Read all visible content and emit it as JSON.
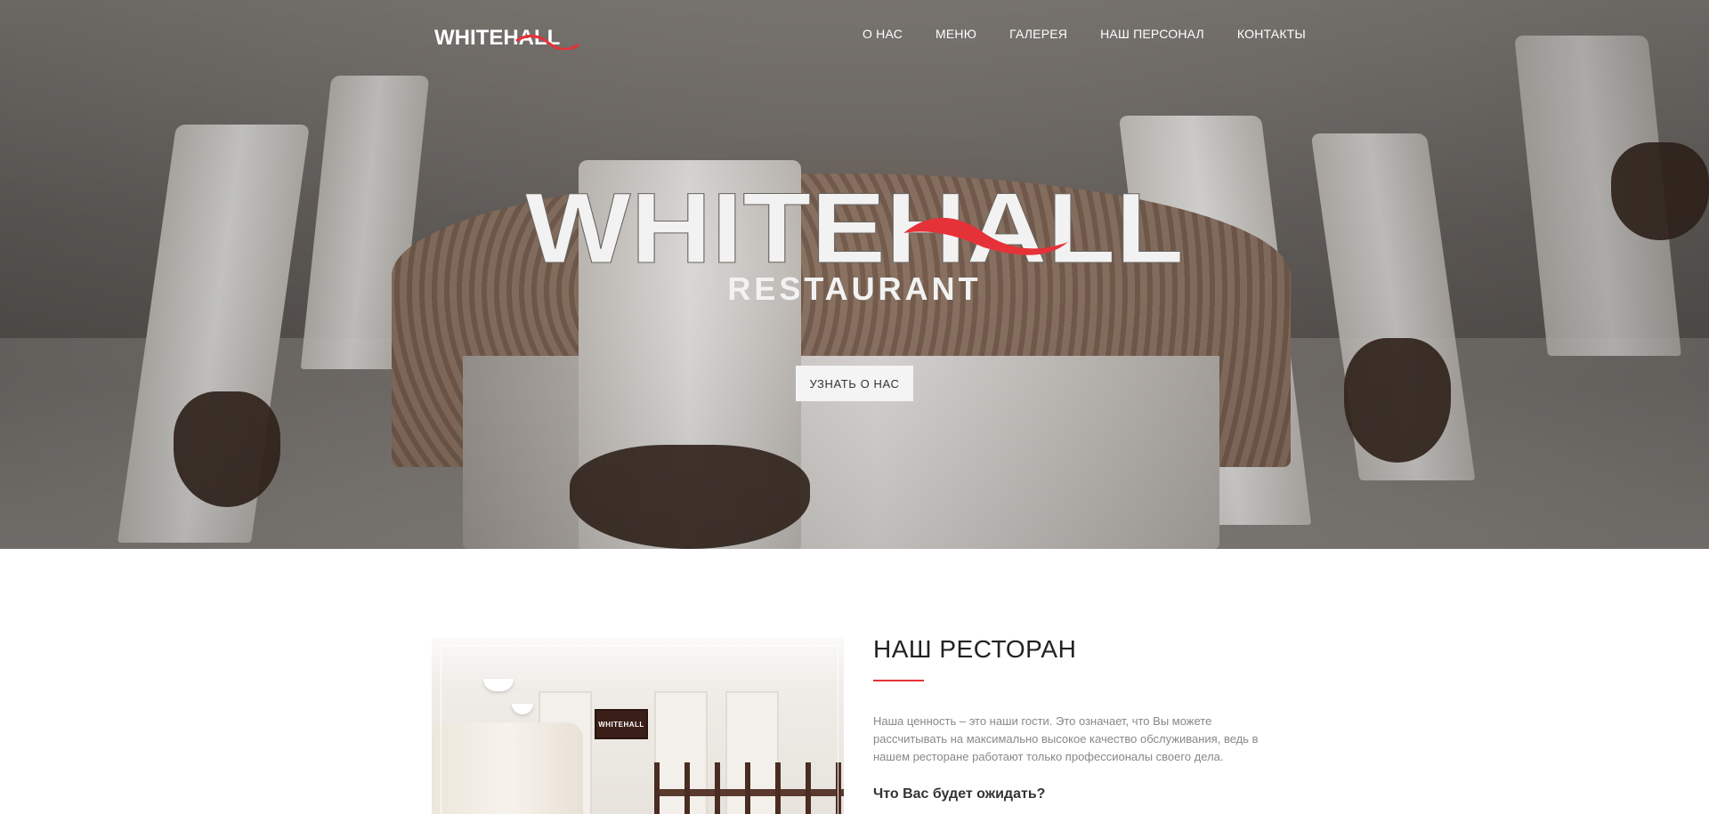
{
  "brand": {
    "name": "WHITEHALL",
    "tagline": "RESTAURANT",
    "accent_color": "#e53238"
  },
  "nav": {
    "items": [
      {
        "label": "О НАС"
      },
      {
        "label": "МЕНЮ"
      },
      {
        "label": "ГАЛЕРЕЯ"
      },
      {
        "label": "НАШ ПЕРСОНАЛ"
      },
      {
        "label": "КОНТАКТЫ"
      }
    ]
  },
  "hero": {
    "cta_label": "УЗНАТЬ О НАС"
  },
  "about": {
    "title": "НАШ РЕСТОРАН",
    "text": "Наша ценность – это наши гости. Это означает, что Вы можете рассчитывать на максимально высокое качество обслуживания, ведь в нашем ресторане работают только профессионалы своего дела.",
    "subtitle": "Что Вас будет ожидать?",
    "photo_sign": "WHITEHALL"
  }
}
